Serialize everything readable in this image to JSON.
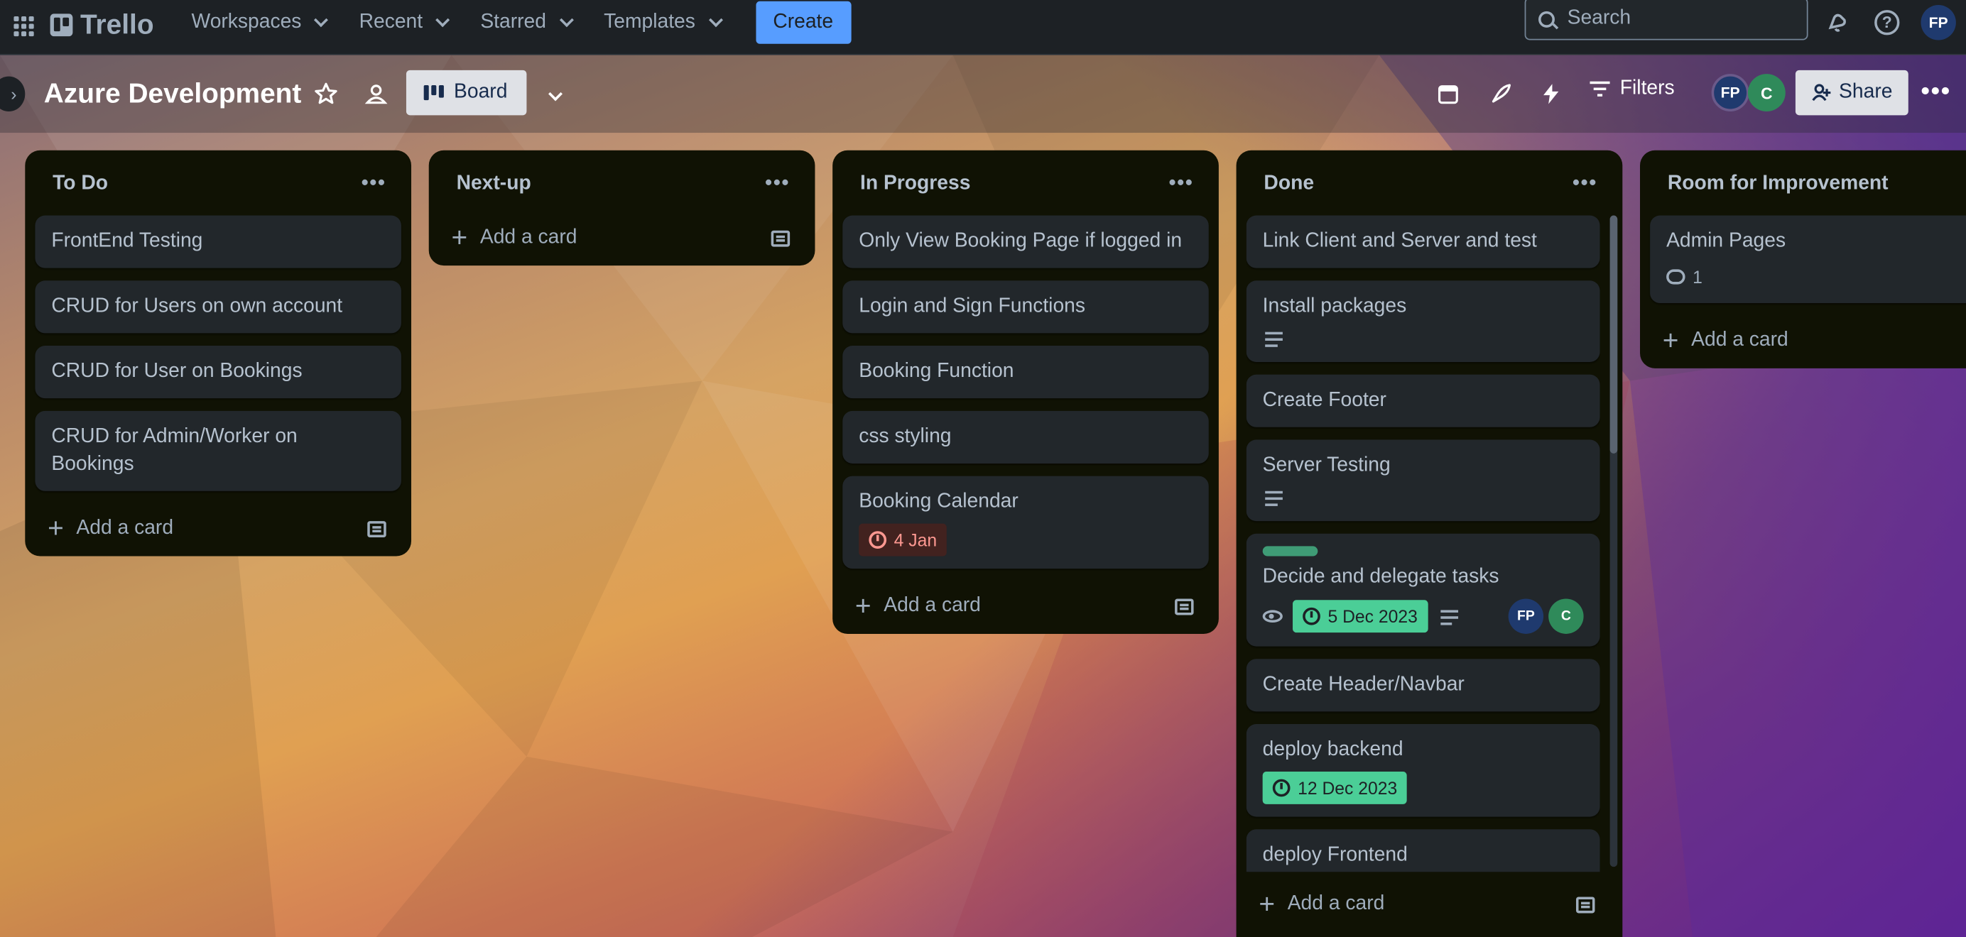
{
  "topnav": {
    "logo": "Trello",
    "menus": [
      "Workspaces",
      "Recent",
      "Starred",
      "Templates"
    ],
    "create_label": "Create",
    "search_placeholder": "Search",
    "user_initials": "FP"
  },
  "board": {
    "title": "Azure Development",
    "view_label": "Board",
    "filters_label": "Filters",
    "share_label": "Share",
    "members": [
      "FP",
      "C"
    ]
  },
  "add_card_label": "Add a card",
  "lists": [
    {
      "title": "To Do",
      "cards": [
        {
          "title": "FrontEnd Testing"
        },
        {
          "title": "CRUD for Users on own account"
        },
        {
          "title": "CRUD for User on Bookings"
        },
        {
          "title": "CRUD for Admin/Worker on Bookings"
        }
      ]
    },
    {
      "title": "Next-up",
      "cards": []
    },
    {
      "title": "In Progress",
      "cards": [
        {
          "title": "Only View Booking Page if logged in"
        },
        {
          "title": "Login and Sign Functions"
        },
        {
          "title": "Booking Function"
        },
        {
          "title": "css styling"
        },
        {
          "title": "Booking Calendar",
          "due": "4 Jan",
          "due_status": "overdue"
        }
      ]
    },
    {
      "title": "Done",
      "cards": [
        {
          "title": "Link Client and Server and test"
        },
        {
          "title": "Install packages",
          "has_description": true
        },
        {
          "title": "Create Footer"
        },
        {
          "title": "Server Testing",
          "has_description": true
        },
        {
          "title": "Decide and delegate tasks",
          "label_color": "#4bce97",
          "watching": true,
          "due": "5 Dec 2023",
          "due_status": "complete",
          "has_description": true,
          "members": [
            "FP",
            "C"
          ]
        },
        {
          "title": "Create Header/Navbar"
        },
        {
          "title": "deploy backend",
          "due": "12 Dec 2023",
          "due_status": "complete"
        },
        {
          "title": "deploy Frontend"
        }
      ]
    },
    {
      "title": "Room for Improvement",
      "cards": [
        {
          "title": "Admin Pages",
          "comments": "1"
        }
      ]
    }
  ],
  "colors": {
    "accent": "#579dff",
    "list_bg": "#101204",
    "card_bg": "#22272b",
    "due_complete": "#4bce97",
    "due_overdue": "#42221f"
  }
}
